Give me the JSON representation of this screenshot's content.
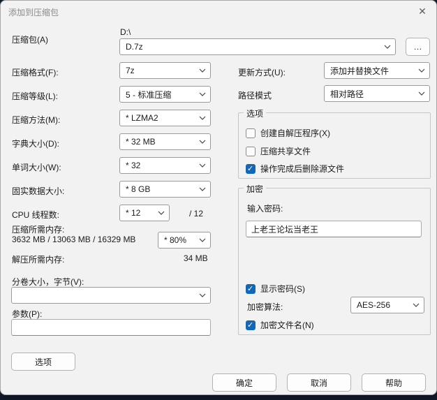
{
  "accent_color": "#1467b8",
  "window": {
    "title": "添加到压缩包",
    "close_icon": "✕"
  },
  "archive": {
    "label": "压缩包(A)",
    "dir": "D:\\",
    "name": "D.7z",
    "browse_label": "…"
  },
  "left": {
    "rows": [
      {
        "label": "压缩格式(F):",
        "value": "7z"
      },
      {
        "label": "压缩等级(L):",
        "value": "5 - 标准压缩"
      },
      {
        "label": "压缩方法(M):",
        "value": "* LZMA2"
      },
      {
        "label": "字典大小(D):",
        "value": "* 32 MB"
      },
      {
        "label": "单词大小(W):",
        "value": "* 32"
      },
      {
        "label": "固实数据大小:",
        "value": "* 8 GB"
      }
    ],
    "cpu": {
      "label": "CPU 线程数:",
      "value": "* 12",
      "suffix": "/ 12"
    },
    "mem_compress": {
      "label": "压缩所需内存:",
      "detail": "3632 MB / 13063 MB / 16329 MB",
      "value": "* 80%"
    },
    "mem_decompress": {
      "label": "解压所需内存:",
      "value": "34 MB"
    },
    "volume": {
      "label": "分卷大小，字节(V):",
      "value": ""
    },
    "params": {
      "label": "参数(P):",
      "value": ""
    },
    "options_button": "选项"
  },
  "right": {
    "update_mode": {
      "label": "更新方式(U):",
      "value": "添加并替换文件"
    },
    "path_mode": {
      "label": "路径模式",
      "value": "相对路径"
    },
    "options_group": {
      "title": "选项",
      "checkboxes": [
        {
          "label": "创建自解压程序(X)",
          "checked": false
        },
        {
          "label": "压缩共享文件",
          "checked": false
        },
        {
          "label": "操作完成后删除源文件",
          "checked": true
        }
      ]
    },
    "encrypt_group": {
      "title": "加密",
      "password_label": "输入密码:",
      "password_value": "上老王论坛当老王",
      "show_password": {
        "label": "显示密码(S)",
        "checked": true
      },
      "method": {
        "label": "加密算法:",
        "value": "AES-256"
      },
      "encrypt_names": {
        "label": "加密文件名(N)",
        "checked": true
      }
    }
  },
  "footer": {
    "ok": "确定",
    "cancel": "取消",
    "help": "帮助"
  }
}
